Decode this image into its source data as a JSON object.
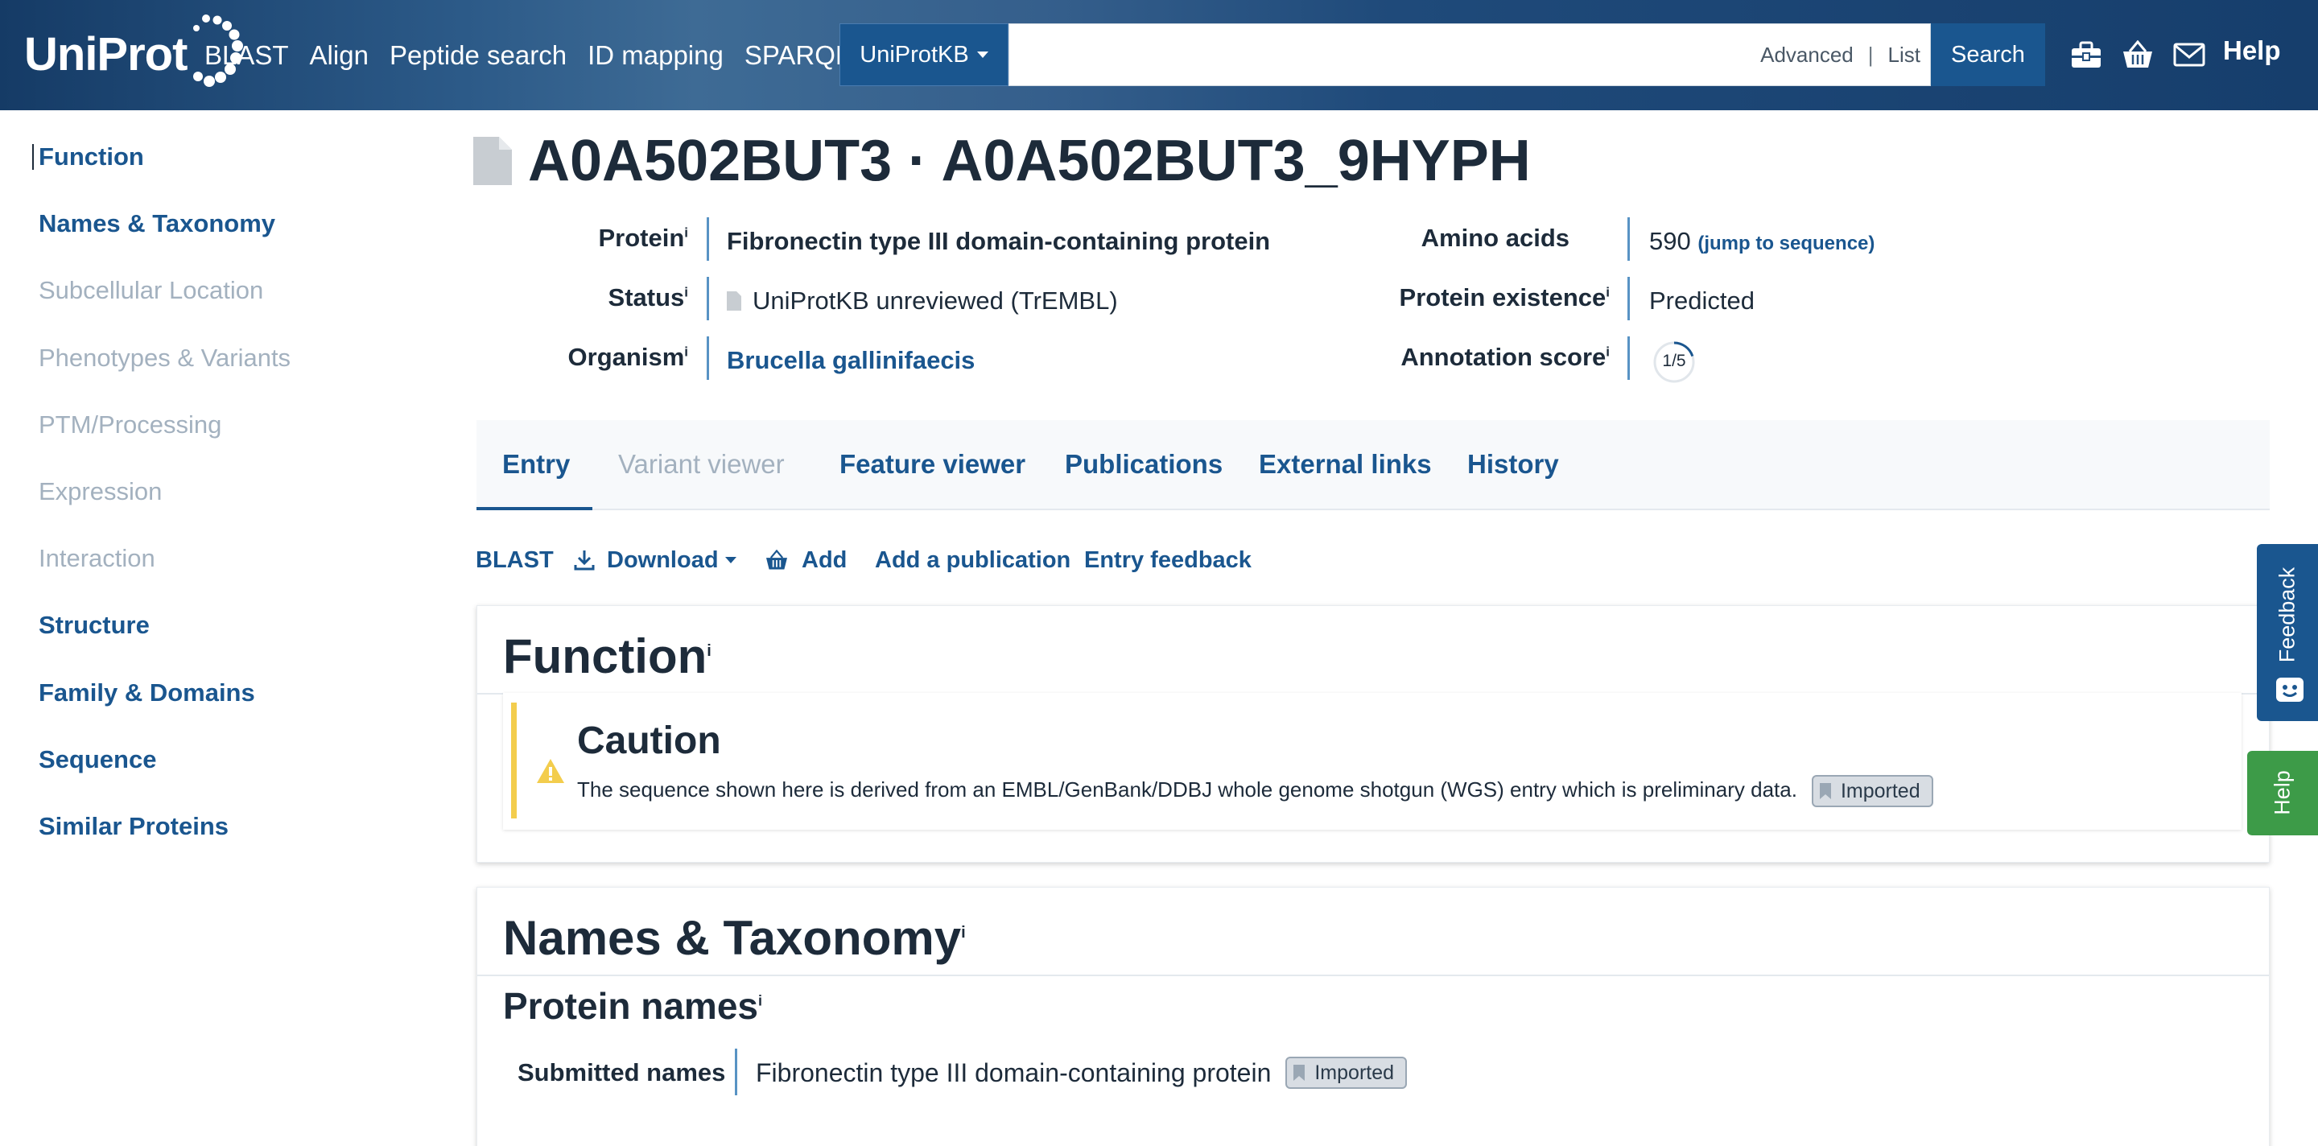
{
  "header": {
    "logo_text": "UniProt",
    "nav": [
      "BLAST",
      "Align",
      "Peptide search",
      "ID mapping",
      "SPARQL"
    ],
    "database_select": "UniProtKB",
    "search_value": "",
    "search_placeholder": "",
    "advanced_label": "Advanced",
    "list_label": "List",
    "search_button": "Search",
    "icons": [
      "toolbox-icon",
      "basket-icon",
      "mail-icon"
    ],
    "help": "Help"
  },
  "sidebar": {
    "items": [
      {
        "label": "Function",
        "state": "active"
      },
      {
        "label": "Names & Taxonomy",
        "state": "enabled"
      },
      {
        "label": "Subcellular Location",
        "state": "disabled"
      },
      {
        "label": "Phenotypes & Variants",
        "state": "disabled"
      },
      {
        "label": "PTM/Processing",
        "state": "disabled"
      },
      {
        "label": "Expression",
        "state": "disabled"
      },
      {
        "label": "Interaction",
        "state": "disabled"
      },
      {
        "label": "Structure",
        "state": "enabled"
      },
      {
        "label": "Family & Domains",
        "state": "enabled"
      },
      {
        "label": "Sequence",
        "state": "enabled"
      },
      {
        "label": "Similar Proteins",
        "state": "enabled"
      }
    ]
  },
  "entry": {
    "title": "A0A502BUT3 · A0A502BUT3_9HYPH",
    "protein_label": "Protein",
    "protein_value": "Fibronectin type III domain-containing protein",
    "status_label": "Status",
    "status_value": "UniProtKB unreviewed (TrEMBL)",
    "organism_label": "Organism",
    "organism_value": "Brucella gallinifaecis",
    "amino_acids_label": "Amino acids",
    "amino_acids_value": "590",
    "jump_link": "(jump to sequence)",
    "existence_label": "Protein existence",
    "existence_value": "Predicted",
    "annotation_label": "Annotation score",
    "annotation_value": "1/5",
    "annotation_score": 1,
    "annotation_max": 5,
    "info_marker": "i"
  },
  "tabs": [
    {
      "label": "Entry",
      "state": "active"
    },
    {
      "label": "Variant viewer",
      "state": "disabled"
    },
    {
      "label": "Feature viewer",
      "state": "enabled"
    },
    {
      "label": "Publications",
      "state": "enabled"
    },
    {
      "label": "External links",
      "state": "enabled"
    },
    {
      "label": "History",
      "state": "enabled"
    }
  ],
  "actions": {
    "blast": "BLAST",
    "download": "Download",
    "add": "Add",
    "add_publication": "Add a publication",
    "entry_feedback": "Entry feedback"
  },
  "function_section": {
    "title": "Function",
    "caution_title": "Caution",
    "caution_text": "The sequence shown here is derived from an EMBL/GenBank/DDBJ whole genome shotgun (WGS) entry which is preliminary data.",
    "badge": "Imported"
  },
  "names_section": {
    "title": "Names & Taxonomy",
    "protein_names_title": "Protein names",
    "submitted_label": "Submitted names",
    "submitted_value": "Fibronectin type III domain-containing protein",
    "badge": "Imported"
  },
  "floating": {
    "feedback": "Feedback",
    "help": "Help"
  },
  "colors": {
    "link": "#1a568f",
    "caution_bar": "#f3cd4d",
    "info_bar": "#5893c4",
    "help_tab": "#3d9b48"
  }
}
